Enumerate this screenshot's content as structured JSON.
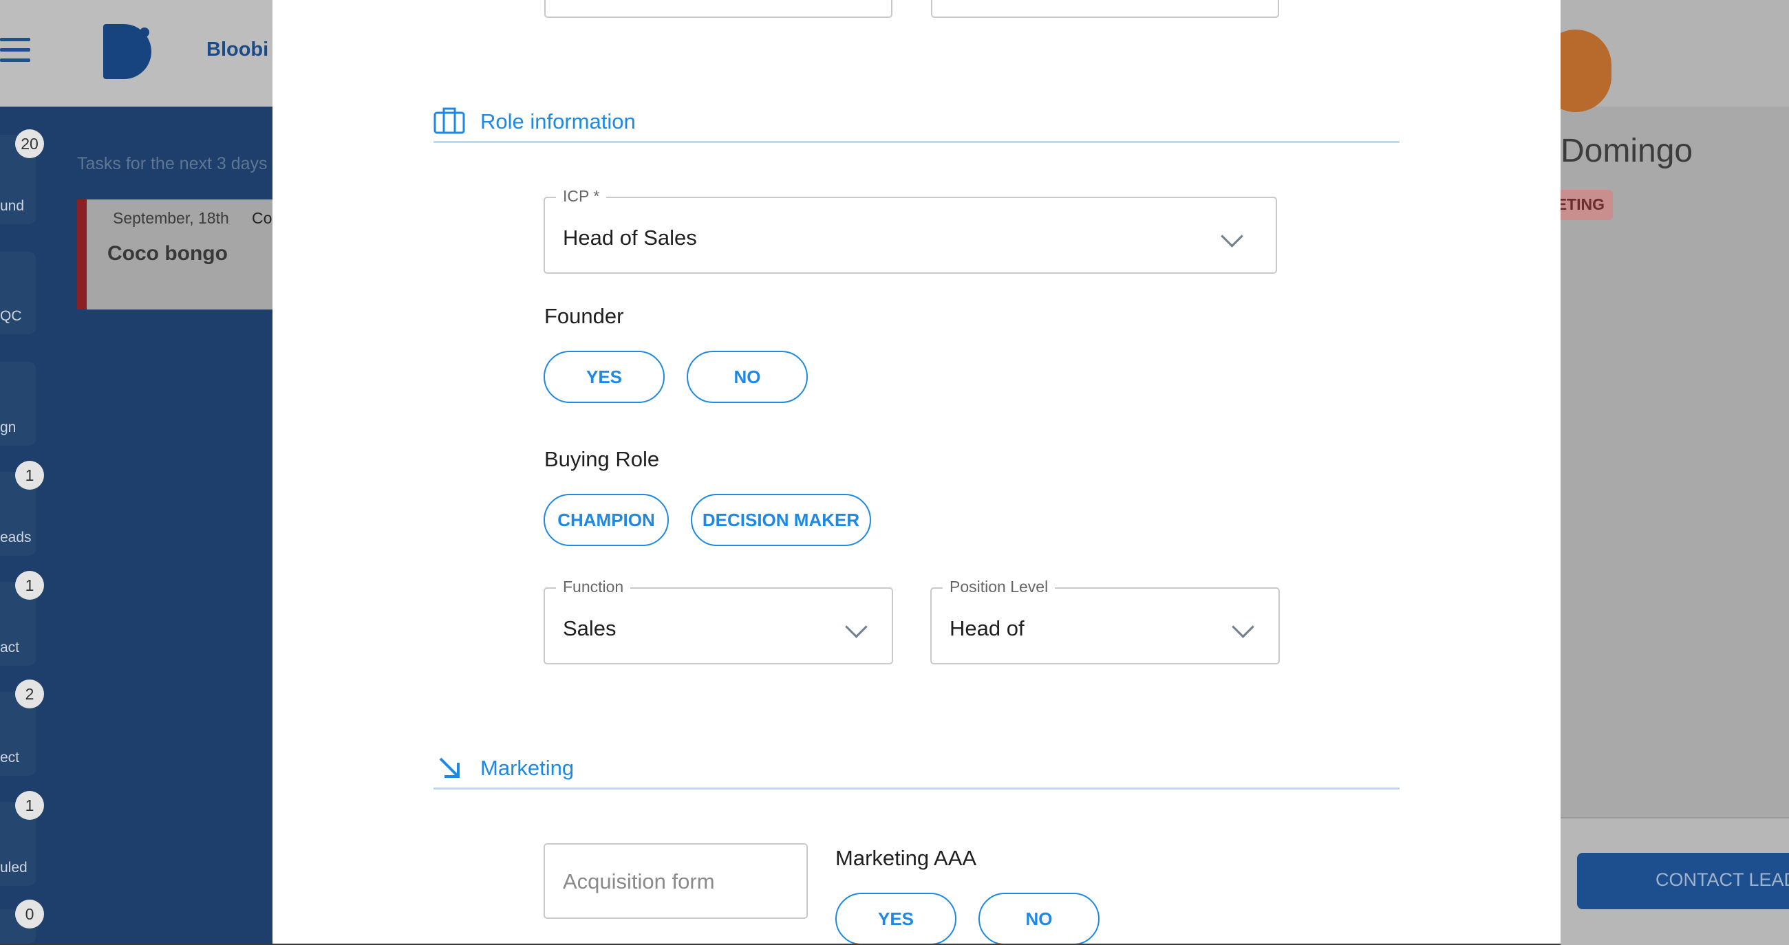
{
  "background": {
    "brand_name": "Bloobi",
    "sidebar": [
      {
        "label": "und",
        "badge": "20"
      },
      {
        "label": "QC",
        "badge": ""
      },
      {
        "label": "gn",
        "badge": ""
      },
      {
        "label": "eads",
        "badge": "1"
      },
      {
        "label": "act",
        "badge": "1"
      },
      {
        "label": "ect",
        "badge": "2"
      },
      {
        "label": "uled",
        "badge": "1"
      },
      {
        "label": "",
        "badge": "0"
      }
    ],
    "tasks_title": "Tasks for the next 3 days",
    "task": {
      "date": "September, 18th",
      "tag": "Con",
      "name": "Coco bongo"
    },
    "lead_name": "Domingo",
    "lead_status": "ETING",
    "contact_button": "CONTACT LEAD"
  },
  "modal": {
    "role_section": {
      "title": "Role information",
      "icon": "briefcase-icon",
      "icp": {
        "label": "ICP *",
        "value": "Head of Sales"
      },
      "founder": {
        "label": "Founder",
        "options": [
          "YES",
          "NO"
        ]
      },
      "buying_role": {
        "label": "Buying Role",
        "options": [
          "CHAMPION",
          "DECISION MAKER"
        ]
      },
      "function": {
        "label": "Function",
        "value": "Sales"
      },
      "position_level": {
        "label": "Position Level",
        "value": "Head of"
      }
    },
    "marketing_section": {
      "title": "Marketing",
      "icon": "arrow-down-right-icon",
      "acquisition_form": {
        "placeholder": "Acquisition form"
      },
      "marketing_aaa": {
        "label": "Marketing AAA",
        "options": [
          "YES",
          "NO"
        ]
      }
    }
  },
  "colors": {
    "accent": "#1e88e5",
    "divider": "#b9d9f6",
    "overlay": "#3a3a3a"
  }
}
